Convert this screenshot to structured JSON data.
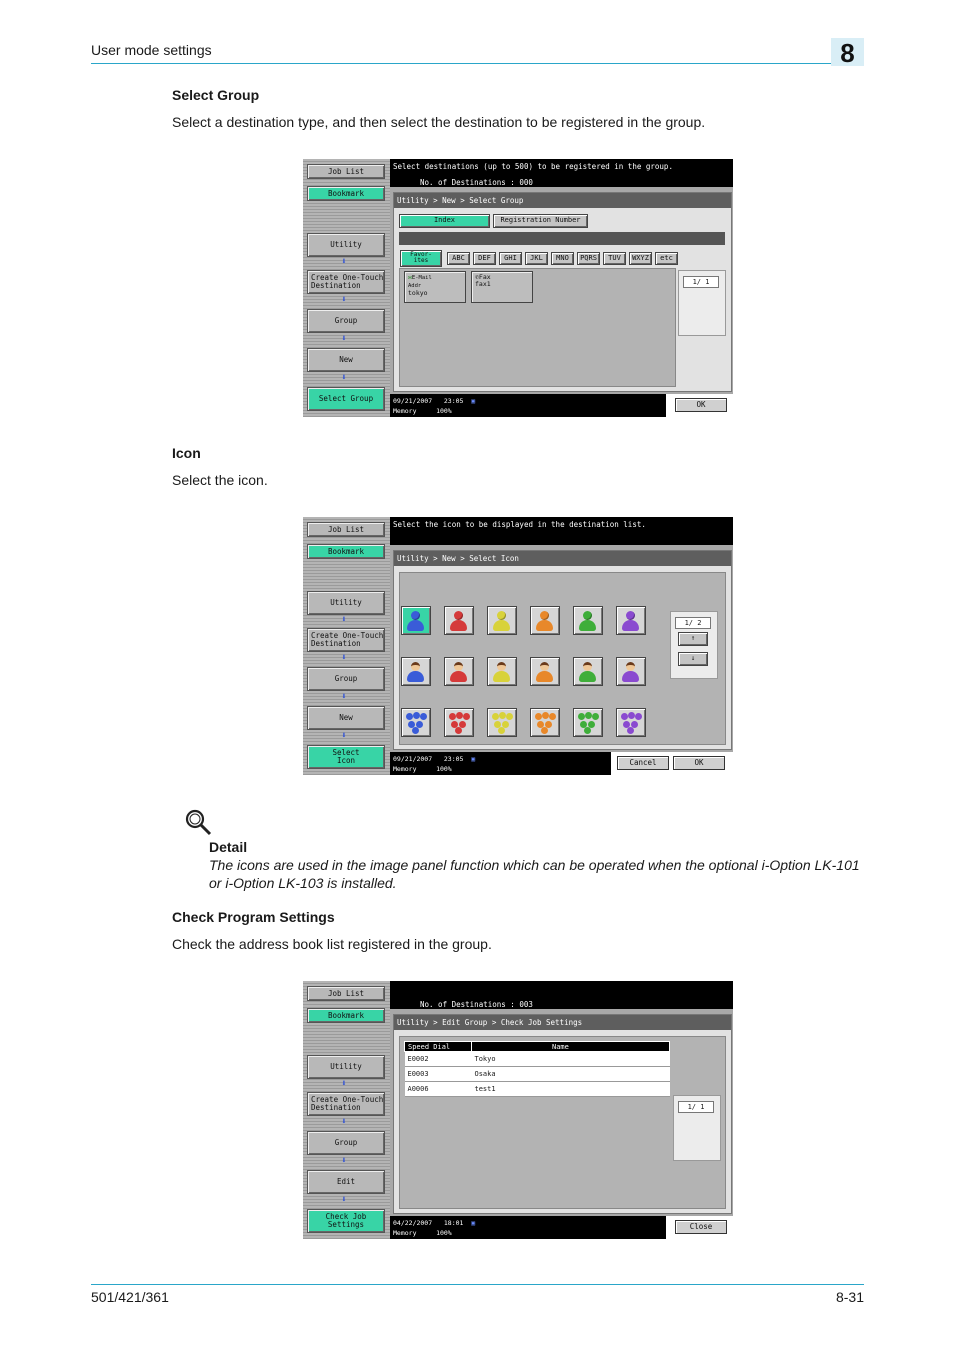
{
  "header": {
    "title": "User mode settings",
    "chapter": "8"
  },
  "sections": [
    {
      "heading": "Select Group",
      "body": "Select a destination type, and then select the destination to be registered in the group."
    },
    {
      "heading": "Icon",
      "body": "Select the icon."
    },
    {
      "heading": "Check Program Settings",
      "body": "Check the address book list registered in the group."
    }
  ],
  "detail": {
    "title": "Detail",
    "text": "The icons are used in the image panel function which can be operated when the optional i-Option LK-101 or i-Option LK-103 is installed."
  },
  "footer": {
    "model": "501/421/361",
    "page": "8-31"
  },
  "screen1": {
    "side": {
      "job_list": "Job List",
      "bookmark": "Bookmark",
      "utility": "Utility",
      "create1": "Create One-Touch",
      "create2": "Destination",
      "group": "Group",
      "new": "New",
      "current": "Select Group"
    },
    "top_line1": "Select destinations (up to 500) to be registered in the group.",
    "top_line2": "No. of Destinations :   000",
    "breadcrumb": "Utility > New > Select Group",
    "tab_index": "Index",
    "tab_reg": "Registration Number",
    "fav1": "Favor-",
    "fav2": "ites",
    "letters": [
      "ABC",
      "DEF",
      "GHI",
      "JKL",
      "MNO",
      "PQRS",
      "TUV",
      "WXYZ",
      "etc"
    ],
    "dest1": {
      "type1": "E-Mail",
      "type2": "Addr",
      "name": "tokyo"
    },
    "dest2": {
      "type": "Fax",
      "name": "fax1"
    },
    "page": "1/  1",
    "date": "09/21/2007",
    "time": "23:05",
    "memory": "Memory",
    "memory_pct": "100%",
    "ok": "OK"
  },
  "screen2": {
    "side": {
      "job_list": "Job List",
      "bookmark": "Bookmark",
      "utility": "Utility",
      "create1": "Create One-Touch",
      "create2": "Destination",
      "group": "Group",
      "new": "New",
      "current1": "Select",
      "current2": "Icon"
    },
    "top_line1": "Select the icon to be displayed in the destination list.",
    "breadcrumb": "Utility > New > Select Icon",
    "page": "1/  2",
    "up": "↑",
    "down": "↓",
    "date": "09/21/2007",
    "time": "23:05",
    "memory": "Memory",
    "memory_pct": "100%",
    "cancel": "Cancel",
    "ok": "OK",
    "colors": [
      "#3a5cd8",
      "#d53a3a",
      "#d8d23a",
      "#e8882a",
      "#3fae3a",
      "#8a4ad0"
    ]
  },
  "screen3": {
    "side": {
      "job_list": "Job List",
      "bookmark": "Bookmark",
      "utility": "Utility",
      "create1": "Create One-Touch",
      "create2": "Destination",
      "group": "Group",
      "edit": "Edit",
      "current1": "Check Job",
      "current2": "Settings"
    },
    "top_line2": "No. of Destinations :   003",
    "breadcrumb": "Utility > Edit Group > Check Job Settings",
    "col_speed": "Speed Dial",
    "col_name": "Name",
    "rows": [
      {
        "code": "E0002",
        "name": "Tokyo"
      },
      {
        "code": "E0003",
        "name": "Osaka"
      },
      {
        "code": "A0006",
        "name": "test1"
      }
    ],
    "page": "1/  1",
    "date": "04/22/2007",
    "time": "18:01",
    "memory": "Memory",
    "memory_pct": "100%",
    "close": "Close"
  }
}
